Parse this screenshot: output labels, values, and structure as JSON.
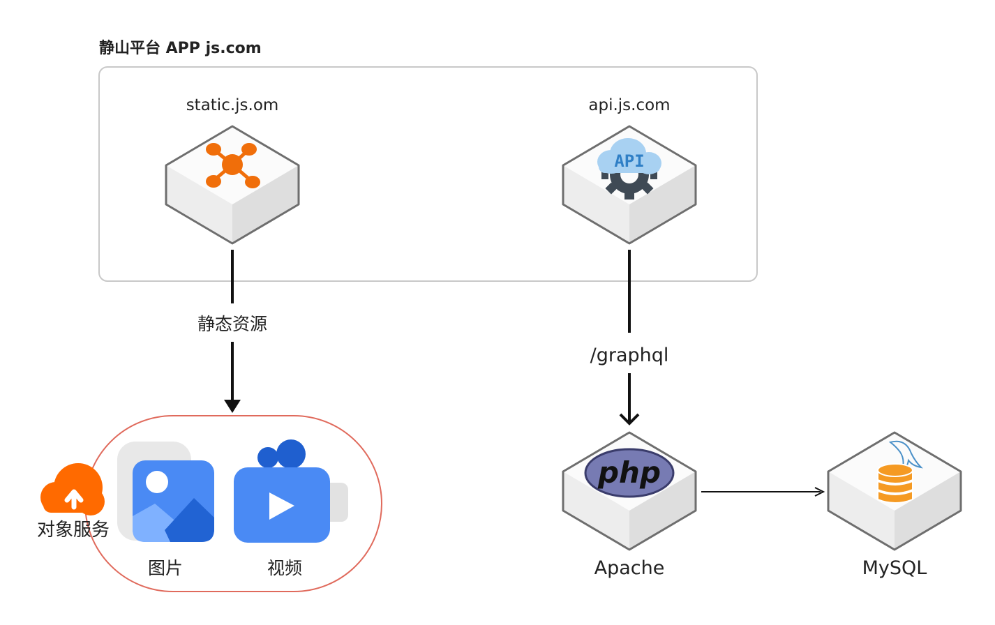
{
  "diagram": {
    "group_title": "静山平台 APP  js.com",
    "nodes": {
      "static": {
        "label": "static.js.om",
        "icon": "network-hub-icon"
      },
      "api": {
        "label": "api.js.com",
        "icon": "api-cloud-gear-icon",
        "icon_text": "API"
      },
      "object_service": {
        "label": "对象服务",
        "icon": "cloud-upload-icon"
      },
      "images": {
        "label": "图片",
        "icon": "image-icon"
      },
      "videos": {
        "label": "视频",
        "icon": "video-icon"
      },
      "apache": {
        "label": "Apache",
        "icon": "php-logo-icon",
        "icon_text": "php"
      },
      "mysql": {
        "label": "MySQL",
        "icon": "mysql-database-icon"
      }
    },
    "edges": {
      "static_to_storage": {
        "label": "静态资源"
      },
      "api_to_apache": {
        "label": "/graphql"
      },
      "apache_to_mysql": {
        "label": ""
      }
    },
    "colors": {
      "group_border": "#c8c8c8",
      "storage_border": "#e06a5c",
      "hub_orange": "#f06e0a",
      "cloud_orange": "#ff6a00",
      "media_blue": "#4a8af4",
      "api_blue": "#3b8fd8",
      "php_purple": "#777bb3",
      "db_orange": "#f59a23"
    }
  }
}
